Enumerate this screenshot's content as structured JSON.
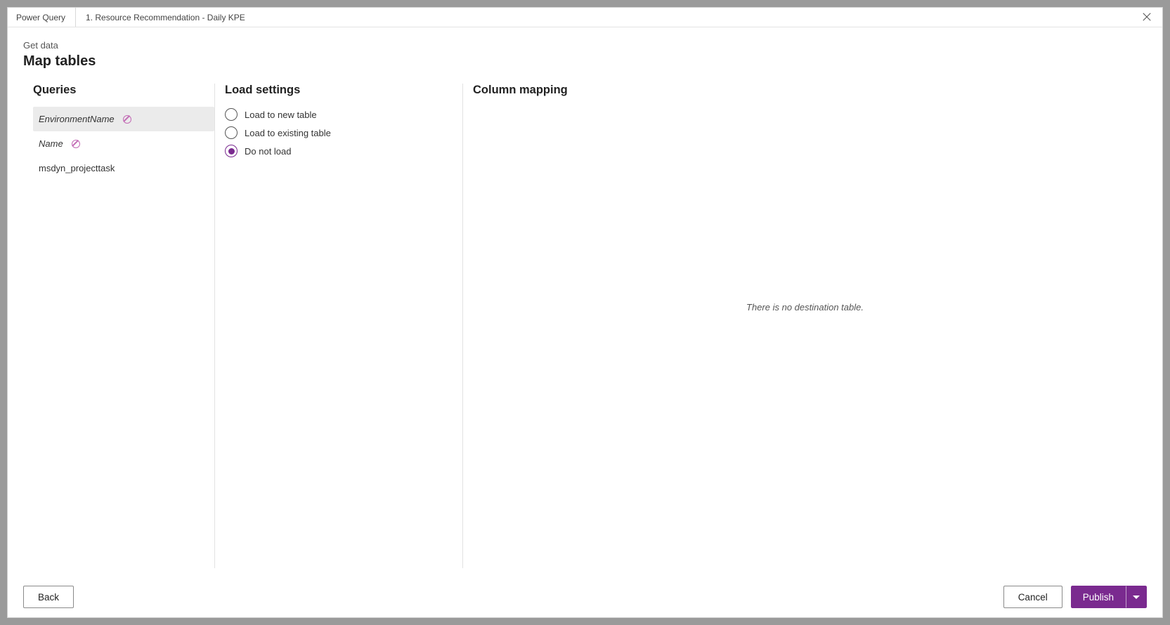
{
  "titlebar": {
    "app": "Power Query",
    "document": "1. Resource Recommendation - Daily KPE"
  },
  "breadcrumb": "Get data",
  "page_title": "Map tables",
  "sections": {
    "queries": {
      "heading": "Queries",
      "items": [
        {
          "label": "EnvironmentName",
          "italic": true,
          "has_do_not_load_icon": true,
          "selected": true
        },
        {
          "label": "Name",
          "italic": true,
          "has_do_not_load_icon": true,
          "selected": false
        },
        {
          "label": "msdyn_projecttask",
          "italic": false,
          "has_do_not_load_icon": false,
          "selected": false
        }
      ]
    },
    "load_settings": {
      "heading": "Load settings",
      "options": [
        {
          "label": "Load to new table",
          "checked": false
        },
        {
          "label": "Load to existing table",
          "checked": false
        },
        {
          "label": "Do not load",
          "checked": true
        }
      ]
    },
    "column_mapping": {
      "heading": "Column mapping",
      "empty_message": "There is no destination table."
    }
  },
  "footer": {
    "back": "Back",
    "cancel": "Cancel",
    "publish": "Publish"
  }
}
